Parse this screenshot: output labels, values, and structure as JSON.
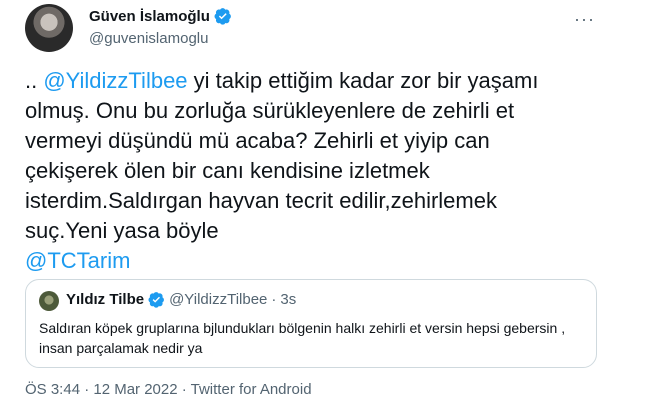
{
  "author": {
    "name": "Güven İslamoğlu",
    "handle": "@guvenislamoglu",
    "verified": true
  },
  "more_icon": "ellipsis-icon",
  "tweet": {
    "prefix": ".. ",
    "mention_1": "@YildizzTilbee",
    "body": " yi takip ettiğim kadar zor bir yaşamı olmuş. Onu bu zorluğa sürükleyenlere de zehirli et vermeyi düşündü mü acaba? Zehirli et yiyip can çekişerek ölen bir canı kendisine izletmek isterdim.Saldırgan hayvan tecrit edilir,zehirlemek suç.Yeni yasa böyle",
    "mention_2": "@TCTarim"
  },
  "quote": {
    "name": "Yıldız Tilbe",
    "handle": "@YildizzTilbee",
    "dot": "·",
    "time": "3s",
    "text": "Saldıran köpek gruplarına bjlundukları bölgenin halkı zehirli et versin hepsi gebersin , insan parçalamak nedir ya"
  },
  "meta": {
    "text": "ÖS 3:44 · 12 Mar 2022 · Twitter for Android"
  },
  "colors": {
    "link": "#1d9bf0",
    "secondary_text": "#536471",
    "border": "#cfd9de"
  }
}
